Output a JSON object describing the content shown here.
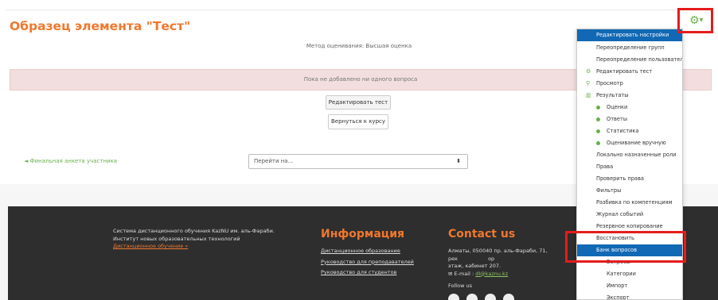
{
  "page": {
    "title": "Образец элемента \"Тест\"",
    "grading_method": "Метод оценивания: Высшая оценка",
    "no_questions_notice": "Пока не добавлено ни одного вопроса",
    "edit_quiz_button": "Редактировать тест",
    "back_to_course_button": "Вернуться к курсу",
    "prev_activity_link": "◄ Финальная анкета участника",
    "jump_to_placeholder": "Перейти на...",
    "jump_to_caret": "⬍"
  },
  "footer": {
    "about_line1": "Система дистанционного обучения KazNU им. аль-Фараби.",
    "about_line2": "Институт новых образовательных технологий",
    "about_link": "Дистанционное обучение »",
    "info_heading": "Информация",
    "info_links": [
      "Дистанционное образование",
      "Руководство для преподавателей",
      "Руководство для студентов"
    ],
    "contact_heading": "Contact us",
    "address_line1": "Алматы, 050040 пр. аль-Фараби, 71, рек",
    "address_fragment": "ор",
    "address_line2": "этаж, кабинет 207.",
    "email_label": "E-mail :",
    "email_value": "dl@kaznu.kz",
    "follow_us": "Follow us"
  },
  "settings_menu": {
    "gear_icon": "gear-icon",
    "items": [
      {
        "label": "Редактировать настройки",
        "level": 0,
        "active": true,
        "icon": ""
      },
      {
        "label": "Переопределение групп",
        "level": 0,
        "icon": ""
      },
      {
        "label": "Переопределение пользователей",
        "level": 0,
        "icon": ""
      },
      {
        "label": "Редактировать тест",
        "level": 1,
        "icon": "gear-icon"
      },
      {
        "label": "Просмотр",
        "level": 1,
        "icon": "magnifier-icon"
      },
      {
        "label": "Результаты",
        "level": 1,
        "icon": "chart-icon"
      },
      {
        "label": "Оценки",
        "level": 2,
        "icon": "bullet-icon"
      },
      {
        "label": "Ответы",
        "level": 2,
        "icon": "bullet-icon"
      },
      {
        "label": "Статистика",
        "level": 2,
        "icon": "bullet-icon"
      },
      {
        "label": "Оценивание вручную",
        "level": 2,
        "icon": "bullet-icon"
      },
      {
        "label": "Локально назначенные роли",
        "level": 0,
        "icon": ""
      },
      {
        "label": "Права",
        "level": 0,
        "icon": ""
      },
      {
        "label": "Проверить права",
        "level": 0,
        "icon": ""
      },
      {
        "label": "Фильтры",
        "level": 0,
        "icon": ""
      },
      {
        "label": "Разбивка по компетенциям",
        "level": 0,
        "icon": ""
      },
      {
        "label": "Журнал событий",
        "level": 0,
        "icon": ""
      },
      {
        "label": "Резервное копирование",
        "level": 0,
        "icon": ""
      },
      {
        "label": "Восстановить",
        "level": 0,
        "icon": ""
      },
      {
        "label": "Банк вопросов",
        "level": 0,
        "active": true,
        "icon": ""
      },
      {
        "label": "Вопросы",
        "level": 3,
        "icon": ""
      },
      {
        "label": "Категории",
        "level": 3,
        "icon": ""
      },
      {
        "label": "Импорт",
        "level": 3,
        "icon": ""
      },
      {
        "label": "Экспорт",
        "level": 3,
        "icon": ""
      }
    ]
  },
  "colors": {
    "accent_orange": "#f0782d",
    "accent_green": "#6ab04c",
    "menu_active": "#1168b4",
    "highlight_red": "#e51b1b",
    "alert_bg": "#f2dede"
  }
}
